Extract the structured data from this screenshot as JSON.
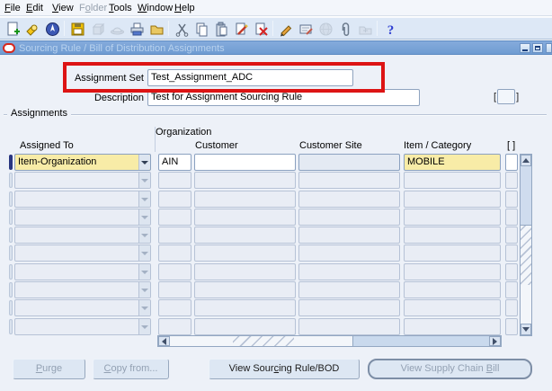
{
  "menu": {
    "items": [
      {
        "label": "File",
        "mnemonic": 0,
        "enabled": true
      },
      {
        "label": "Edit",
        "mnemonic": 0,
        "enabled": true
      },
      {
        "label": "View",
        "mnemonic": 0,
        "enabled": true
      },
      {
        "label": "Folder",
        "mnemonic": 1,
        "enabled": false
      },
      {
        "label": "Tools",
        "mnemonic": 0,
        "enabled": true
      },
      {
        "label": "Window",
        "mnemonic": 0,
        "enabled": true
      },
      {
        "label": "Help",
        "mnemonic": 0,
        "enabled": true
      }
    ]
  },
  "toolbar": {
    "icons": [
      {
        "name": "new",
        "enabled": true
      },
      {
        "name": "find",
        "enabled": true
      },
      {
        "name": "show-navigator",
        "enabled": true
      },
      {
        "name": "save",
        "enabled": true
      },
      {
        "name": "next-step",
        "enabled": false
      },
      {
        "name": "switch-responsibility",
        "enabled": false
      },
      {
        "name": "print",
        "enabled": true
      },
      {
        "name": "close-form",
        "enabled": true
      },
      {
        "name": "cut",
        "enabled": true
      },
      {
        "name": "copy",
        "enabled": true
      },
      {
        "name": "paste",
        "enabled": true
      },
      {
        "name": "clear-record",
        "enabled": true
      },
      {
        "name": "delete-record",
        "enabled": true
      },
      {
        "name": "edit-field",
        "enabled": true
      },
      {
        "name": "translations",
        "enabled": true
      },
      {
        "name": "window-help",
        "enabled": false
      },
      {
        "name": "attachments",
        "enabled": true
      },
      {
        "name": "folder-tools",
        "enabled": false
      },
      {
        "name": "help",
        "enabled": true
      }
    ],
    "separators_after": [
      2,
      7,
      12,
      17
    ]
  },
  "window": {
    "title": "Sourcing Rule / Bill of Distribution Assignments",
    "controls": [
      "minimize",
      "maximize",
      "close"
    ]
  },
  "form": {
    "assignment_set": {
      "label": "Assignment Set",
      "value": "Test_Assignment_ADC"
    },
    "description": {
      "label": "Description",
      "value": "Test for Assignment Sourcing Rule"
    },
    "description_flexfield": "[ ]",
    "section_title": "Assignments"
  },
  "grid": {
    "group_header": "Organization",
    "columns": [
      "Assigned To",
      "Customer",
      "Customer Site",
      "Item / Category",
      "[ ]"
    ],
    "rows": [
      {
        "assigned_to": "Item-Organization",
        "organization": "AIN",
        "customer": "",
        "customer_site": "",
        "item_category": "MOBILE",
        "active": true
      },
      {
        "assigned_to": "",
        "organization": "",
        "customer": "",
        "customer_site": "",
        "item_category": "",
        "active": false
      },
      {
        "assigned_to": "",
        "organization": "",
        "customer": "",
        "customer_site": "",
        "item_category": "",
        "active": false
      },
      {
        "assigned_to": "",
        "organization": "",
        "customer": "",
        "customer_site": "",
        "item_category": "",
        "active": false
      },
      {
        "assigned_to": "",
        "organization": "",
        "customer": "",
        "customer_site": "",
        "item_category": "",
        "active": false
      },
      {
        "assigned_to": "",
        "organization": "",
        "customer": "",
        "customer_site": "",
        "item_category": "",
        "active": false
      },
      {
        "assigned_to": "",
        "organization": "",
        "customer": "",
        "customer_site": "",
        "item_category": "",
        "active": false
      },
      {
        "assigned_to": "",
        "organization": "",
        "customer": "",
        "customer_site": "",
        "item_category": "",
        "active": false
      },
      {
        "assigned_to": "",
        "organization": "",
        "customer": "",
        "customer_site": "",
        "item_category": "",
        "active": false
      },
      {
        "assigned_to": "",
        "organization": "",
        "customer": "",
        "customer_site": "",
        "item_category": "",
        "active": false
      }
    ]
  },
  "buttons": [
    {
      "label": "Purge",
      "mnemonic": 0,
      "enabled": false,
      "default": false
    },
    {
      "label": "Copy from...",
      "mnemonic": 0,
      "enabled": false,
      "default": false
    },
    {
      "label": "View Sourcing Rule/BOD",
      "mnemonic": 9,
      "enabled": true,
      "default": false
    },
    {
      "label": "View Supply Chain Bill",
      "mnemonic": 18,
      "enabled": false,
      "default": true
    }
  ],
  "colors": {
    "highlight_yellow": "#f8eca7",
    "titlebar_blue": "#7aa5d8",
    "annotation_red": "#dd1414",
    "record_indicator_blue": "#283580",
    "content_background": "#edf1f8"
  }
}
